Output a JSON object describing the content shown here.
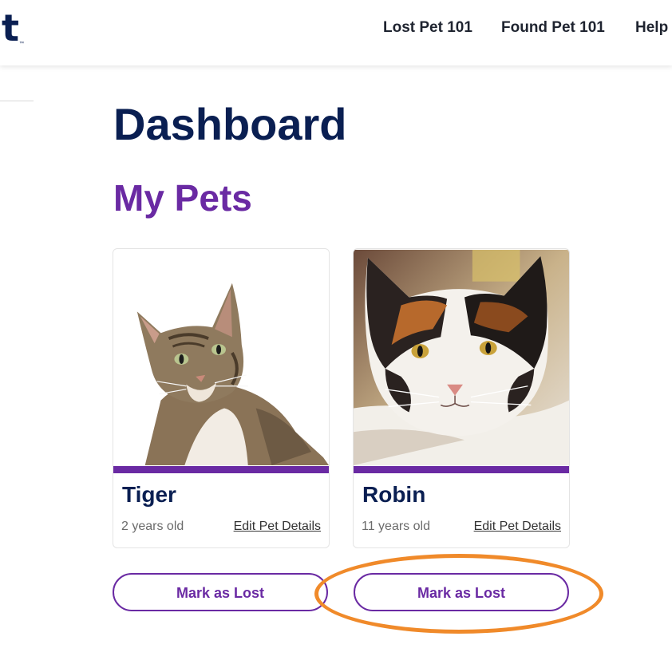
{
  "header": {
    "logo_text": "t",
    "logo_tm": "™",
    "nav": {
      "lost_pet": "Lost Pet 101",
      "found_pet": "Found Pet 101",
      "help": "Help"
    }
  },
  "page": {
    "title": "Dashboard",
    "section_title": "My Pets"
  },
  "pets": [
    {
      "name": "Tiger",
      "age": "2 years old",
      "edit_label": "Edit Pet Details",
      "mark_lost_label": "Mark as Lost",
      "photo": "tabby-cat-photo"
    },
    {
      "name": "Robin",
      "age": "11 years old",
      "edit_label": "Edit Pet Details",
      "mark_lost_label": "Mark as Lost",
      "photo": "calico-cat-photo"
    }
  ],
  "colors": {
    "navy": "#0a1f52",
    "purple": "#6a2aa3",
    "highlight_orange": "#f08a2a"
  }
}
